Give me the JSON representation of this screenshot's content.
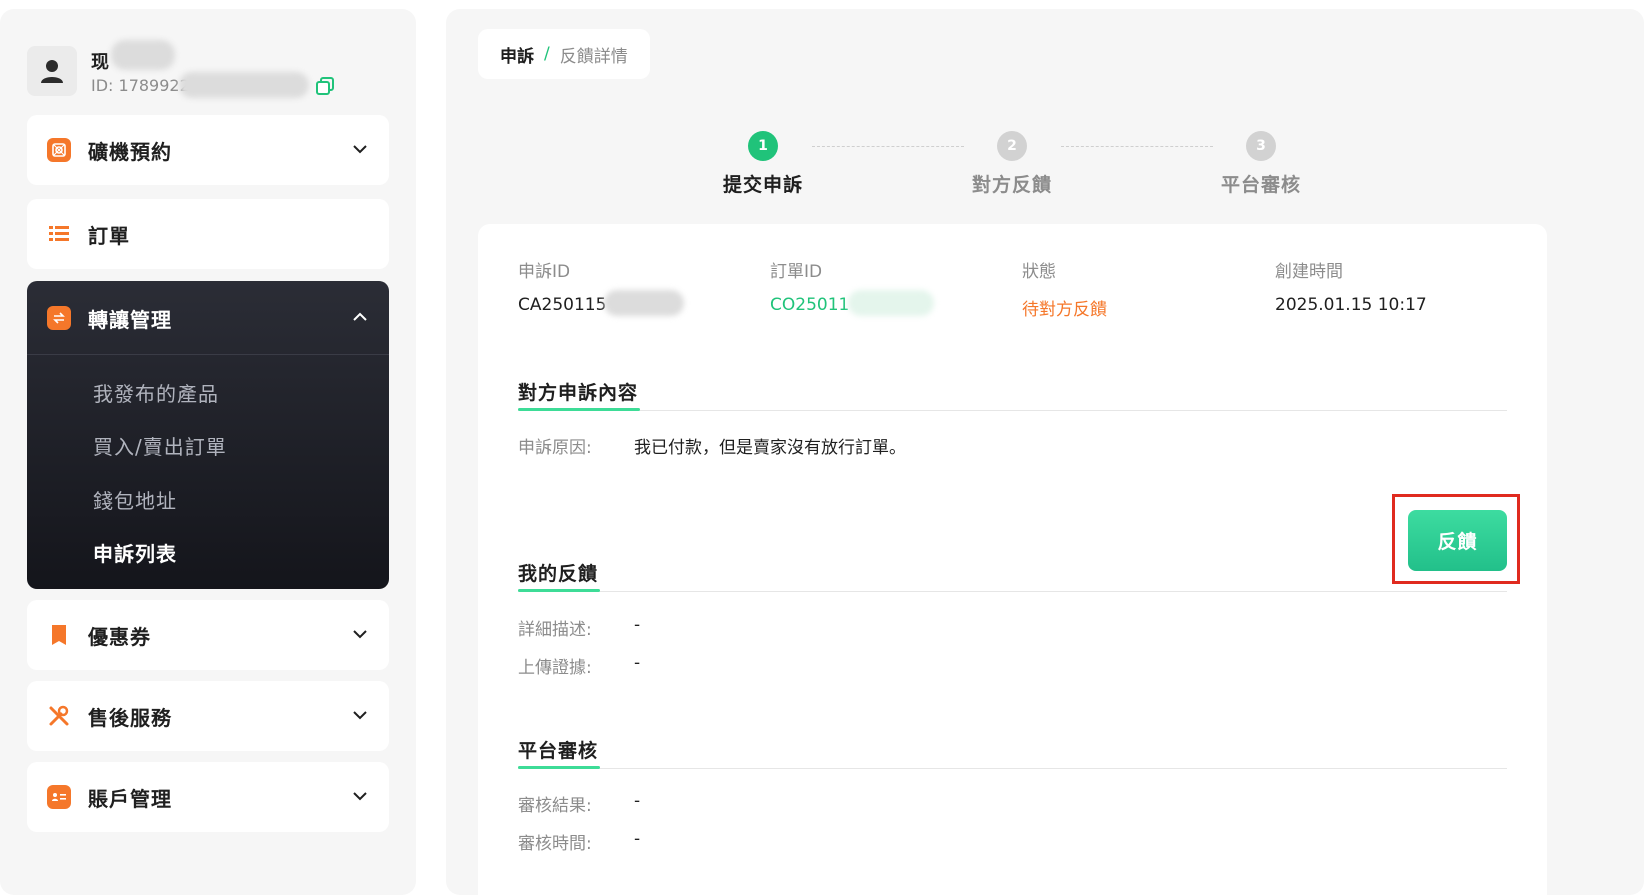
{
  "user": {
    "name": "现",
    "id": "ID: 1789922",
    "copy_icon": "copy-icon"
  },
  "sidebar": {
    "items": [
      {
        "label": "礦機預約",
        "icon": "mining-icon",
        "expanded": false
      },
      {
        "label": "訂單",
        "icon": "list-icon",
        "expanded": false
      },
      {
        "label": "轉讓管理",
        "icon": "transfer-icon",
        "expanded": true,
        "children": [
          {
            "label": "我發布的產品",
            "active": false
          },
          {
            "label": "買入/賣出訂單",
            "active": false
          },
          {
            "label": "錢包地址",
            "active": false
          },
          {
            "label": "申訴列表",
            "active": true
          }
        ]
      },
      {
        "label": "優惠券",
        "icon": "coupon-icon",
        "expanded": false
      },
      {
        "label": "售後服務",
        "icon": "tools-icon",
        "expanded": false
      },
      {
        "label": "賬戶管理",
        "icon": "account-card-icon",
        "expanded": false
      }
    ]
  },
  "breadcrumb": {
    "parent": "申訴",
    "separator": "/",
    "current": "反饋詳情"
  },
  "steps": [
    {
      "number": "1",
      "label": "提交申訴",
      "active": true
    },
    {
      "number": "2",
      "label": "對方反饋",
      "active": false
    },
    {
      "number": "3",
      "label": "平台審核",
      "active": false
    }
  ],
  "info": {
    "appeal_id_label": "申訴ID",
    "appeal_id": "CA250115",
    "order_id_label": "訂單ID",
    "order_id": "CO25011",
    "status_label": "狀態",
    "status": "待對方反饋",
    "created_label": "創建時間",
    "created": "2025.01.15 10:17"
  },
  "sections": {
    "opponent": {
      "title": "對方申訴內容",
      "reason_label": "申訴原因:",
      "reason": "我已付款，但是賣家沒有放行訂單。"
    },
    "mine": {
      "title": "我的反饋",
      "desc_label": "詳細描述:",
      "desc": "-",
      "evidence_label": "上傳證據:",
      "evidence": "-"
    },
    "platform": {
      "title": "平台審核",
      "result_label": "審核結果:",
      "result": "-",
      "time_label": "審核時間:",
      "time": "-"
    }
  },
  "feedback_button": "反饋",
  "colors": {
    "accent": "#20c37a",
    "status": "#f5772a",
    "highlight": "#e02a1f"
  }
}
